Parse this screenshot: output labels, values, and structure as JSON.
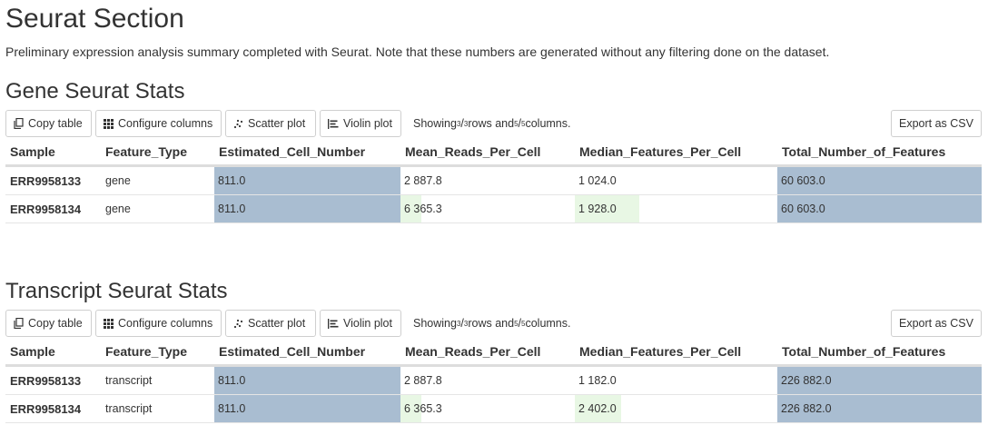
{
  "page": {
    "title": "Seurat Section",
    "intro": "Preliminary expression analysis summary completed with Seurat. Note that these numbers are generated without any filtering done on the dataset."
  },
  "toolbar": {
    "copy_label": "Copy table",
    "configure_label": "Configure columns",
    "scatter_label": "Scatter plot",
    "violin_label": "Violin plot",
    "export_label": "Export as CSV",
    "showing_prefix": "Showing ",
    "rows_shown": "3",
    "rows_total": "3",
    "rows_word": " rows and ",
    "cols_shown": "5",
    "cols_total": "5",
    "cols_word": " columns."
  },
  "columns": [
    "Sample",
    "Feature_Type",
    "Estimated_Cell_Number",
    "Mean_Reads_Per_Cell",
    "Median_Features_Per_Cell",
    "Total_Number_of_Features"
  ],
  "colors": {
    "bar_blue": "#a9bdd1",
    "bar_green": "#e8f7e4"
  },
  "gene": {
    "title": "Gene Seurat Stats",
    "rows": [
      {
        "sample": "ERR9958133",
        "feature_type": "gene",
        "est": {
          "text": "811.0",
          "fill": 1.0,
          "color": "blue"
        },
        "mean": {
          "text": "2 887.8",
          "fill": 0.0,
          "color": "green"
        },
        "median": {
          "text": "1 024.0",
          "fill": 0.0,
          "color": "green"
        },
        "total": {
          "text": "60 603.0",
          "fill": 1.0,
          "color": "blue"
        }
      },
      {
        "sample": "ERR9958134",
        "feature_type": "gene",
        "est": {
          "text": "811.0",
          "fill": 1.0,
          "color": "blue"
        },
        "mean": {
          "text": "6 365.3",
          "fill": 0.12,
          "color": "green"
        },
        "median": {
          "text": "1 928.0",
          "fill": 0.32,
          "color": "green"
        },
        "total": {
          "text": "60 603.0",
          "fill": 1.0,
          "color": "blue"
        }
      }
    ]
  },
  "transcript": {
    "title": "Transcript Seurat Stats",
    "rows": [
      {
        "sample": "ERR9958133",
        "feature_type": "transcript",
        "est": {
          "text": "811.0",
          "fill": 1.0,
          "color": "blue"
        },
        "mean": {
          "text": "2 887.8",
          "fill": 0.0,
          "color": "green"
        },
        "median": {
          "text": "1 182.0",
          "fill": 0.0,
          "color": "green"
        },
        "total": {
          "text": "226 882.0",
          "fill": 1.0,
          "color": "blue"
        }
      },
      {
        "sample": "ERR9958134",
        "feature_type": "transcript",
        "est": {
          "text": "811.0",
          "fill": 1.0,
          "color": "blue"
        },
        "mean": {
          "text": "6 365.3",
          "fill": 0.12,
          "color": "green"
        },
        "median": {
          "text": "2 402.0",
          "fill": 0.23,
          "color": "green"
        },
        "total": {
          "text": "226 882.0",
          "fill": 1.0,
          "color": "blue"
        }
      }
    ]
  }
}
